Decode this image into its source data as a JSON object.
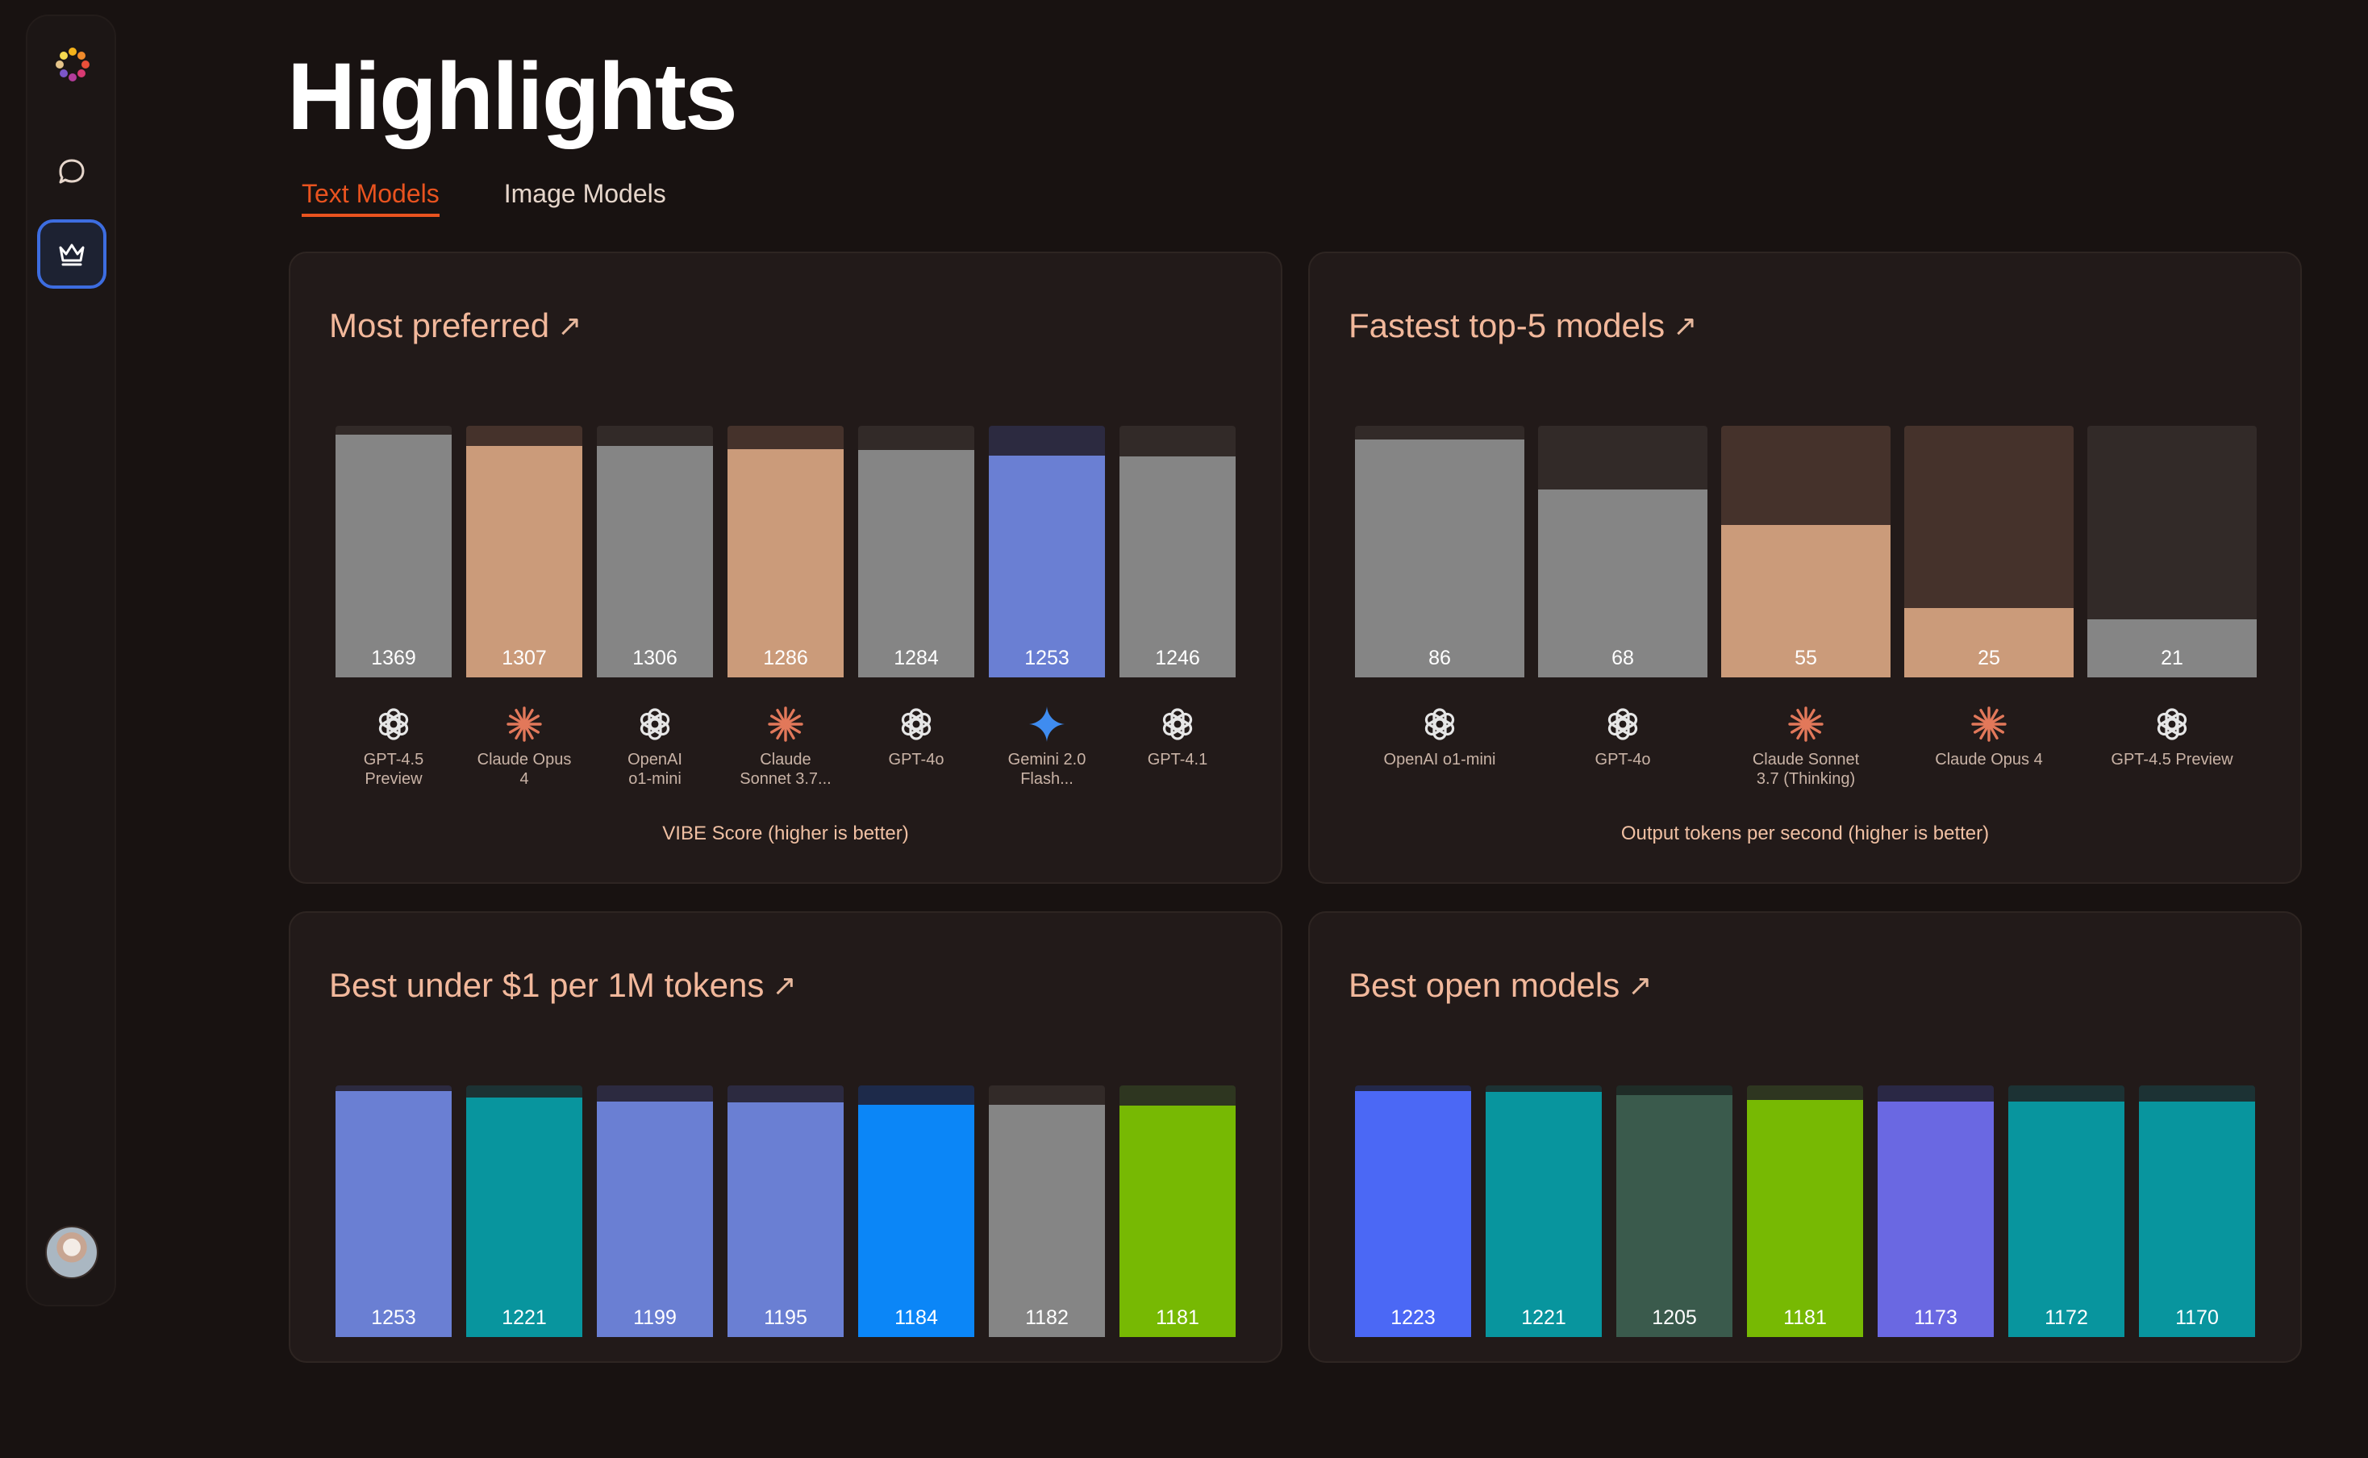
{
  "page": {
    "title": "Highlights"
  },
  "tabs": [
    {
      "label": "Text Models",
      "active": true
    },
    {
      "label": "Image Models",
      "active": false
    }
  ],
  "sidebar": {
    "items": [
      "chat-icon",
      "crown-icon"
    ],
    "active": "crown-icon"
  },
  "colors": {
    "gpt": "#858585",
    "claude": "#cb9b7a",
    "gemini": "#6a7fd3",
    "openai_blue": "#6a7fd3",
    "accent": "#e9531f"
  },
  "cards": [
    {
      "title": "Most preferred",
      "caption": "VIBE Score (higher is better)",
      "max": 1420,
      "bars": [
        {
          "value": 1369,
          "label": "GPT-4.5 Preview",
          "lines": [
            "GPT-4.5",
            "Preview"
          ],
          "logo": "openai-icon",
          "color": "#858585",
          "track": "#322a28"
        },
        {
          "value": 1307,
          "label": "Claude Opus 4",
          "lines": [
            "Claude Opus",
            "4"
          ],
          "logo": "claude-icon",
          "color": "#cb9b7a",
          "track": "#45322b"
        },
        {
          "value": 1306,
          "label": "OpenAI o1-mini",
          "lines": [
            "OpenAI",
            "o1-mini"
          ],
          "logo": "openai-icon",
          "color": "#858585",
          "track": "#322a28"
        },
        {
          "value": 1286,
          "label": "Claude Sonnet 3.7...",
          "lines": [
            "Claude",
            "Sonnet 3.7..."
          ],
          "logo": "claude-icon",
          "color": "#cb9b7a",
          "track": "#45322b"
        },
        {
          "value": 1284,
          "label": "GPT-4o",
          "lines": [
            "GPT-4o"
          ],
          "logo": "openai-icon",
          "color": "#858585",
          "track": "#322a28"
        },
        {
          "value": 1253,
          "label": "Gemini 2.0 Flash...",
          "lines": [
            "Gemini 2.0",
            "Flash..."
          ],
          "logo": "gemini-icon",
          "color": "#6a7fd3",
          "track": "#2c2a40"
        },
        {
          "value": 1246,
          "label": "GPT-4.1",
          "lines": [
            "GPT-4.1"
          ],
          "logo": "openai-icon",
          "color": "#858585",
          "track": "#322a28"
        }
      ]
    },
    {
      "title": "Fastest top-5 models",
      "caption": "Output tokens per second (higher is better)",
      "max": 91,
      "bars": [
        {
          "value": 86,
          "label": "OpenAI o1-mini",
          "lines": [
            "OpenAI o1-mini"
          ],
          "logo": "openai-icon",
          "color": "#858585",
          "track": "#322a28"
        },
        {
          "value": 68,
          "label": "GPT-4o",
          "lines": [
            "GPT-4o"
          ],
          "logo": "openai-icon",
          "color": "#858585",
          "track": "#322a28"
        },
        {
          "value": 55,
          "label": "Claude Sonnet 3.7 (Thinking)",
          "lines": [
            "Claude Sonnet",
            "3.7 (Thinking)"
          ],
          "logo": "claude-icon",
          "color": "#cb9b7a",
          "track": "#45322b"
        },
        {
          "value": 25,
          "label": "Claude Opus 4",
          "lines": [
            "Claude Opus 4"
          ],
          "logo": "claude-icon",
          "color": "#cb9b7a",
          "track": "#45322b"
        },
        {
          "value": 21,
          "label": "GPT-4.5 Preview",
          "lines": [
            "GPT-4.5 Preview"
          ],
          "logo": "openai-icon",
          "color": "#858585",
          "track": "#322a28"
        }
      ]
    },
    {
      "title": "Best under $1 per 1M tokens",
      "caption": "",
      "max": 1282,
      "bars": [
        {
          "value": 1253,
          "label": "",
          "lines": [],
          "logo": "",
          "color": "#6a7fd3",
          "track": "#2c2a40"
        },
        {
          "value": 1221,
          "label": "",
          "lines": [],
          "logo": "",
          "color": "#08959e",
          "track": "#1c3234"
        },
        {
          "value": 1199,
          "label": "",
          "lines": [],
          "logo": "",
          "color": "#6a7fd3",
          "track": "#2c2a40"
        },
        {
          "value": 1195,
          "label": "",
          "lines": [],
          "logo": "",
          "color": "#6a7fd3",
          "track": "#2c2a40"
        },
        {
          "value": 1184,
          "label": "",
          "lines": [],
          "logo": "",
          "color": "#0b86f7",
          "track": "#1d2a4a"
        },
        {
          "value": 1182,
          "label": "",
          "lines": [],
          "logo": "",
          "color": "#858585",
          "track": "#322a28"
        },
        {
          "value": 1181,
          "label": "",
          "lines": [],
          "logo": "",
          "color": "#77b903",
          "track": "#2e3620"
        }
      ]
    },
    {
      "title": "Best open models",
      "caption": "",
      "max": 1252,
      "bars": [
        {
          "value": 1223,
          "label": "",
          "lines": [],
          "logo": "",
          "color": "#4b68f5",
          "track": "#23284a"
        },
        {
          "value": 1221,
          "label": "",
          "lines": [],
          "logo": "",
          "color": "#08959e",
          "track": "#1c3234"
        },
        {
          "value": 1205,
          "label": "",
          "lines": [],
          "logo": "",
          "color": "#3a5a4c",
          "track": "#1f2c27"
        },
        {
          "value": 1181,
          "label": "",
          "lines": [],
          "logo": "",
          "color": "#77b903",
          "track": "#2e3620"
        },
        {
          "value": 1173,
          "label": "",
          "lines": [],
          "logo": "",
          "color": "#6a68e2",
          "track": "#2a2845"
        },
        {
          "value": 1172,
          "label": "",
          "lines": [],
          "logo": "",
          "color": "#08959e",
          "track": "#1c3234"
        },
        {
          "value": 1170,
          "label": "",
          "lines": [],
          "logo": "",
          "color": "#08959e",
          "track": "#1c3234"
        }
      ]
    }
  ]
}
